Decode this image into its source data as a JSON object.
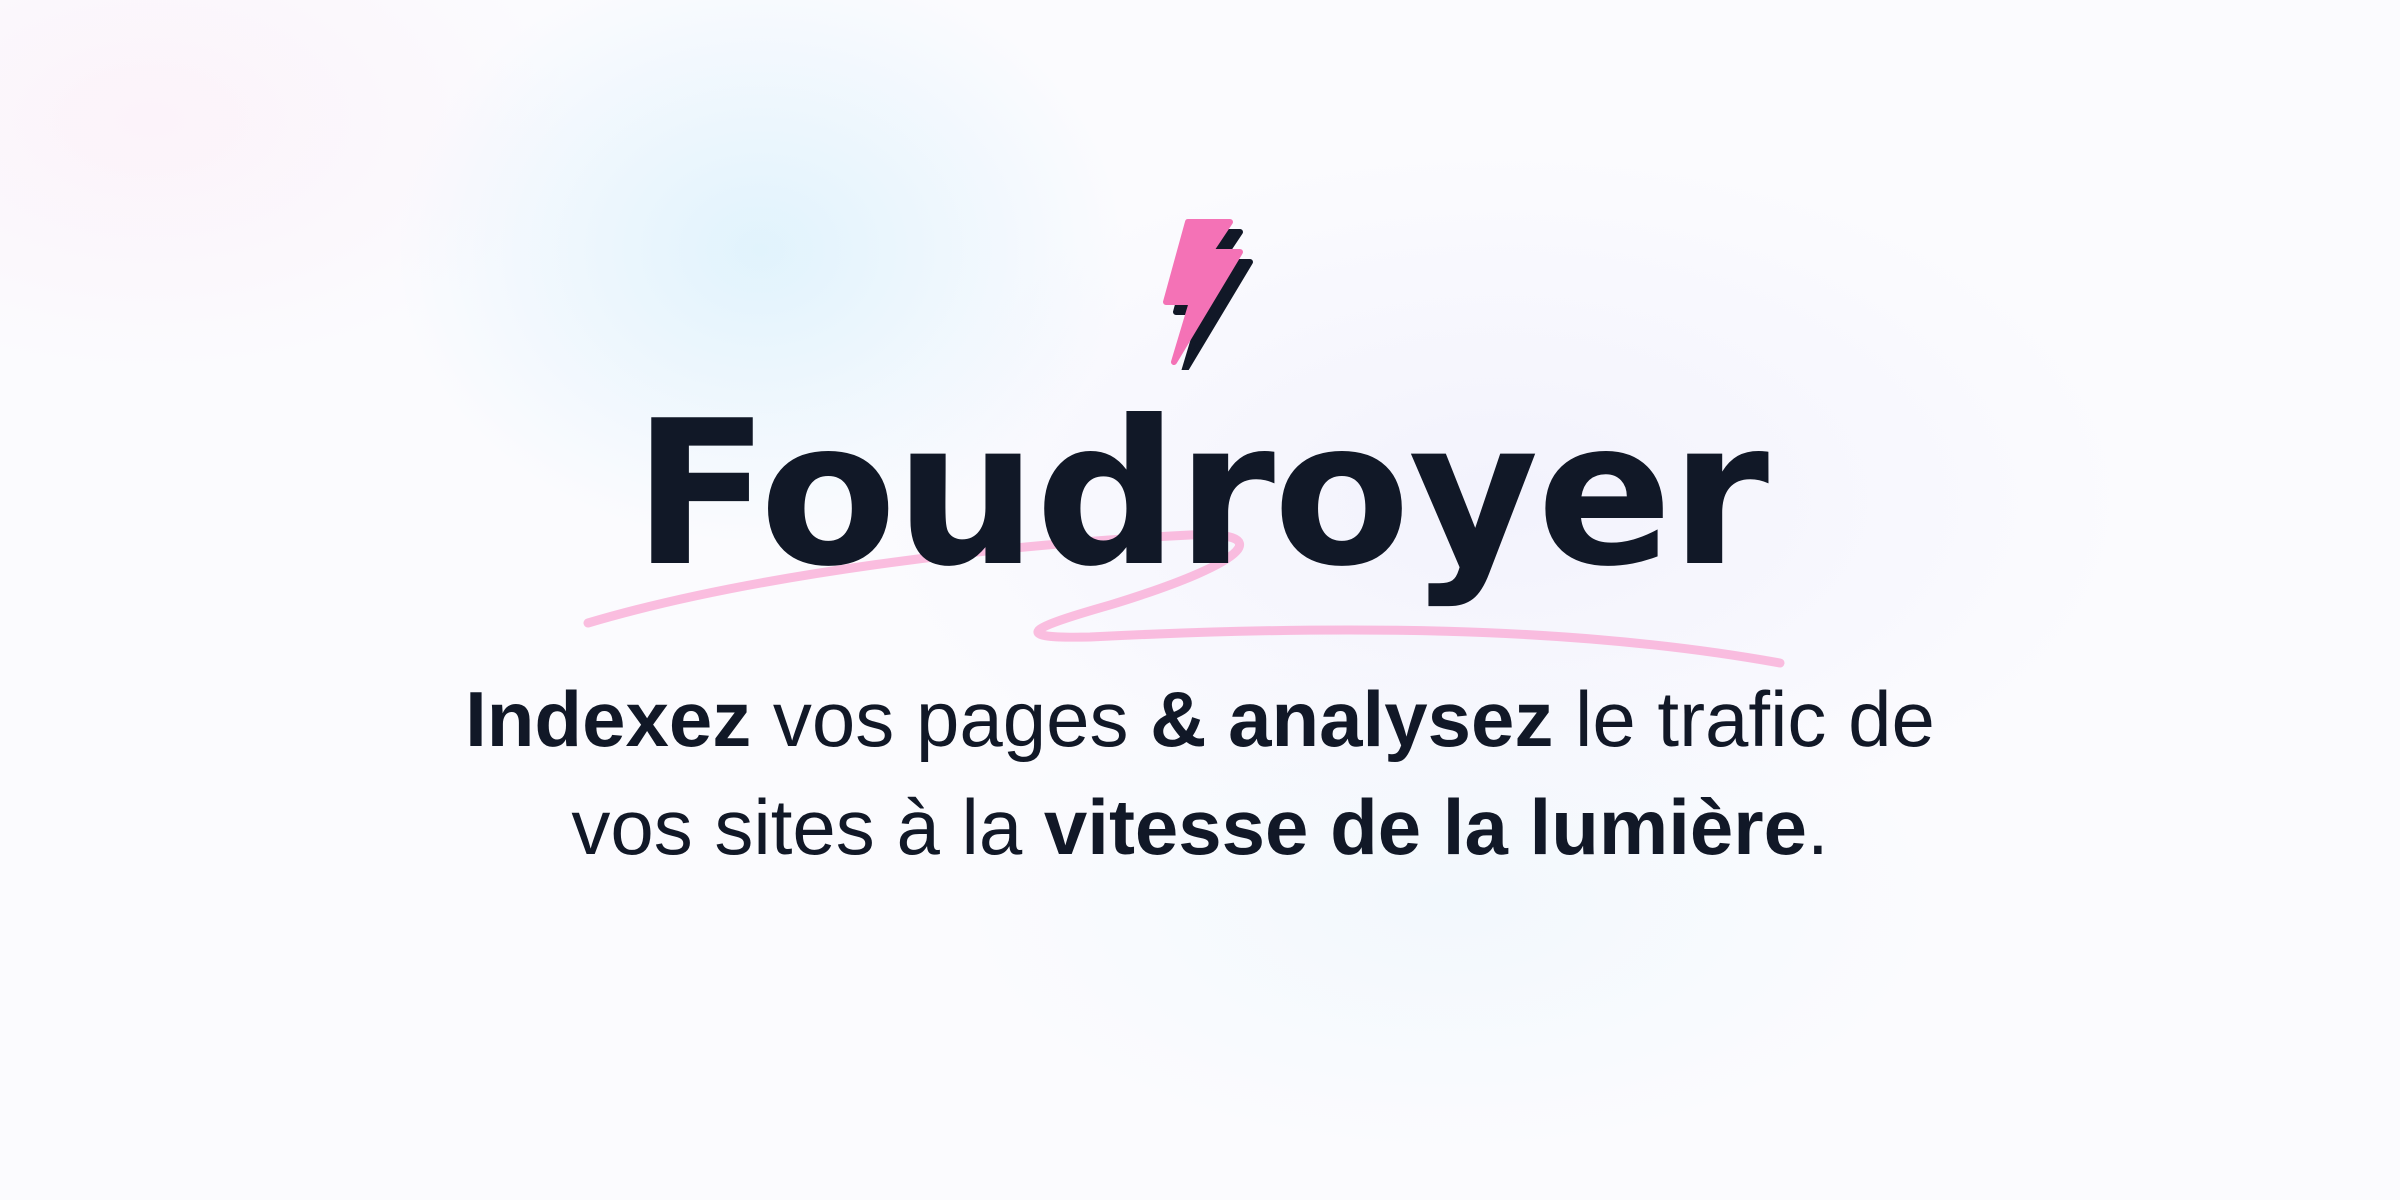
{
  "hero": {
    "logo_icon": "lightning-bolt-icon",
    "title": "Foudroyer",
    "tagline": {
      "line1": [
        {
          "text": "Indexez",
          "bold": true
        },
        {
          "text": " vos pages ",
          "bold": false
        },
        {
          "text": "& analysez",
          "bold": true
        },
        {
          "text": " le trafic de",
          "bold": false
        }
      ],
      "line2": [
        {
          "text": "vos sites à la ",
          "bold": false
        },
        {
          "text": "vitesse de la lumière",
          "bold": true
        },
        {
          "text": ".",
          "bold": false
        }
      ]
    }
  },
  "colors": {
    "text": "#111827",
    "accent_pink": "#f472b6",
    "swash_pink": "#f9a8d4"
  }
}
